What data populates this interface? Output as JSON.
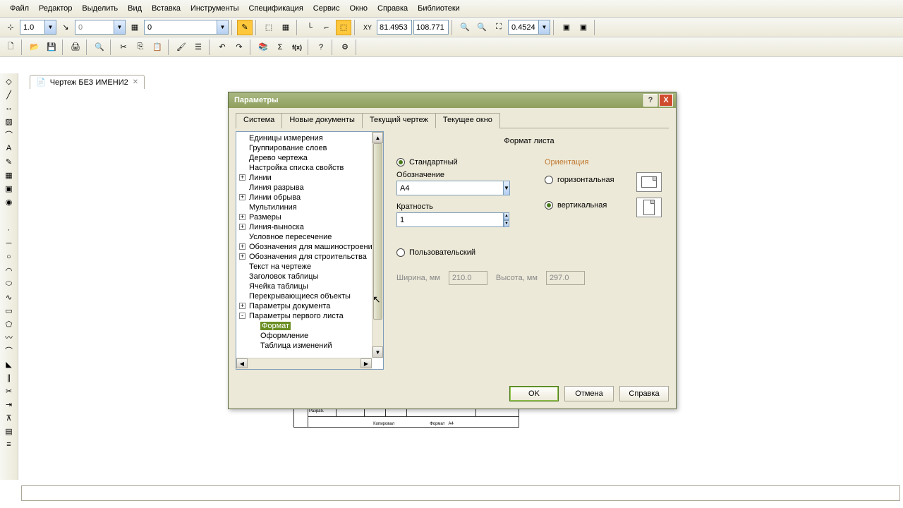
{
  "menu": [
    "Файл",
    "Редактор",
    "Выделить",
    "Вид",
    "Вставка",
    "Инструменты",
    "Спецификация",
    "Сервис",
    "Окно",
    "Справка",
    "Библиотеки"
  ],
  "toolbar1": {
    "val1": "1.0",
    "val2": "0",
    "val3": "0",
    "coord_x": "81.4953",
    "coord_y": "108.771",
    "zoom": "0.4524"
  },
  "doc_tab": "Чертеж БЕЗ ИМЕНИ2",
  "dialog": {
    "title": "Параметры",
    "tabs": [
      "Система",
      "Новые документы",
      "Текущий чертеж",
      "Текущее окно"
    ],
    "active_tab": 2,
    "tree": [
      {
        "label": "Единицы измерения",
        "expand": null,
        "indent": 0
      },
      {
        "label": "Группирование слоев",
        "expand": null,
        "indent": 0
      },
      {
        "label": "Дерево чертежа",
        "expand": null,
        "indent": 0
      },
      {
        "label": "Настройка списка свойств",
        "expand": null,
        "indent": 0
      },
      {
        "label": "Линии",
        "expand": "+",
        "indent": 0
      },
      {
        "label": "Линия разрыва",
        "expand": null,
        "indent": 0
      },
      {
        "label": "Линии обрыва",
        "expand": "+",
        "indent": 0
      },
      {
        "label": "Мультилиния",
        "expand": null,
        "indent": 0
      },
      {
        "label": "Размеры",
        "expand": "+",
        "indent": 0
      },
      {
        "label": "Линия-выноска",
        "expand": "+",
        "indent": 0
      },
      {
        "label": "Условное пересечение",
        "expand": null,
        "indent": 0
      },
      {
        "label": "Обозначения для машиностроения",
        "expand": "+",
        "indent": 0
      },
      {
        "label": "Обозначения для строительства",
        "expand": "+",
        "indent": 0
      },
      {
        "label": "Текст на чертеже",
        "expand": null,
        "indent": 0
      },
      {
        "label": "Заголовок таблицы",
        "expand": null,
        "indent": 0
      },
      {
        "label": "Ячейка таблицы",
        "expand": null,
        "indent": 0
      },
      {
        "label": "Перекрывающиеся объекты",
        "expand": null,
        "indent": 0
      },
      {
        "label": "Параметры документа",
        "expand": "+",
        "indent": 0
      },
      {
        "label": "Параметры первого листа",
        "expand": "-",
        "indent": 0
      },
      {
        "label": "Формат",
        "expand": null,
        "indent": 1,
        "selected": true
      },
      {
        "label": "Оформление",
        "expand": null,
        "indent": 1
      },
      {
        "label": "Таблица изменений",
        "expand": null,
        "indent": 1
      }
    ],
    "right": {
      "section": "Формат листа",
      "standard": "Стандартный",
      "designation": "Обозначение",
      "designation_val": "A4",
      "multiplicity": "Кратность",
      "multiplicity_val": "1",
      "orientation": "Ориентация",
      "horizontal": "горизонтальная",
      "vertical": "вертикальная",
      "custom": "Пользовательский",
      "width_lbl": "Ширина, мм",
      "width_val": "210.0",
      "height_lbl": "Высота, мм",
      "height_val": "297.0"
    },
    "buttons": {
      "ok": "OK",
      "cancel": "Отмена",
      "help": "Справка"
    }
  }
}
